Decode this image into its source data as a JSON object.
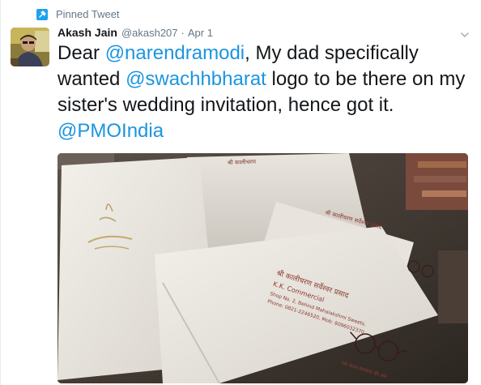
{
  "pinned": {
    "label": "Pinned Tweet",
    "icon": "pin-icon"
  },
  "author": {
    "fullname": "Akash Jain",
    "username": "@akash207",
    "separator": "·",
    "timestamp": "Apr 1"
  },
  "tweet": {
    "t1": "Dear ",
    "m1": "@narendramodi",
    "t2": ", My dad specifically wanted ",
    "m2": "@swachhbharat",
    "t3": " logo to be there on my sister's wedding invitation, hence got it. ",
    "m3": "@PMOIndia"
  },
  "media": {
    "card_lines": {
      "c1": "K.K. Commercial",
      "c2": "Phone: 0821-2246520, Mob: 8096032370"
    }
  },
  "colors": {
    "link": "#1b95e0",
    "secondary_text": "#657786",
    "text": "#14171a",
    "pin_bg": "#1da1f2"
  }
}
